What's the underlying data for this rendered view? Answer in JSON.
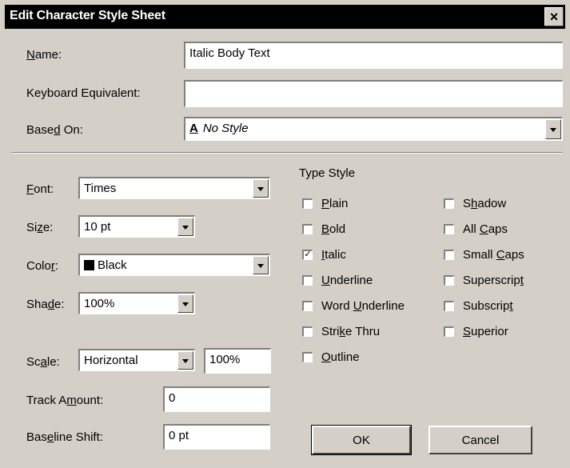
{
  "window": {
    "title": "Edit Character Style Sheet",
    "close_label": "×"
  },
  "fields": {
    "name": {
      "label_pre": "",
      "label_key": "N",
      "label_post": "ame:",
      "value": "Italic Body Text"
    },
    "keyboard": {
      "label": "Keyboard Equivalent:",
      "value": ""
    },
    "based_on": {
      "label_pre": "Base",
      "label_key": "d",
      "label_post": " On:",
      "icon": "A",
      "value": "No Style"
    }
  },
  "left": {
    "font": {
      "label_pre": "",
      "label_key": "F",
      "label_post": "ont:",
      "value": "Times"
    },
    "size": {
      "label_pre": "Si",
      "label_key": "z",
      "label_post": "e:",
      "value": "10 pt"
    },
    "color": {
      "label_pre": "Colo",
      "label_key": "r",
      "label_post": ":",
      "value": "Black",
      "swatch": "#000000"
    },
    "shade": {
      "label_pre": "Sha",
      "label_key": "d",
      "label_post": "e:",
      "value": "100%"
    },
    "scale": {
      "label_pre": "Sc",
      "label_key": "a",
      "label_post": "le:",
      "mode": "Horizontal",
      "value": "100%"
    },
    "track": {
      "label_pre": "Track A",
      "label_key": "m",
      "label_post": "ount:",
      "value": "0"
    },
    "baseline": {
      "label_pre": "Bas",
      "label_key": "e",
      "label_post": "line Shift:",
      "value": "0 pt"
    }
  },
  "type_style": {
    "heading": "Type Style",
    "col1": [
      {
        "pre": "",
        "key": "P",
        "post": "lain",
        "checked": false
      },
      {
        "pre": "",
        "key": "B",
        "post": "old",
        "checked": false
      },
      {
        "pre": "",
        "key": "I",
        "post": "talic",
        "checked": true
      },
      {
        "pre": "",
        "key": "U",
        "post": "nderline",
        "checked": false
      },
      {
        "pre": "Word ",
        "key": "U",
        "post": "nderline",
        "checked": false
      },
      {
        "pre": "Stri",
        "key": "k",
        "post": "e Thru",
        "checked": false
      },
      {
        "pre": "",
        "key": "O",
        "post": "utline",
        "checked": false
      }
    ],
    "col2": [
      {
        "pre": "S",
        "key": "h",
        "post": "adow",
        "checked": false
      },
      {
        "pre": "All ",
        "key": "C",
        "post": "aps",
        "checked": false
      },
      {
        "pre": "Small ",
        "key": "C",
        "post": "aps",
        "checked": false
      },
      {
        "pre": "Superscrip",
        "key": "t",
        "post": "",
        "checked": false
      },
      {
        "pre": "Subscrip",
        "key": "t",
        "post": "",
        "checked": false
      },
      {
        "pre": "",
        "key": "S",
        "post": "uperior",
        "checked": false
      }
    ]
  },
  "buttons": {
    "ok": "OK",
    "cancel": "Cancel"
  }
}
